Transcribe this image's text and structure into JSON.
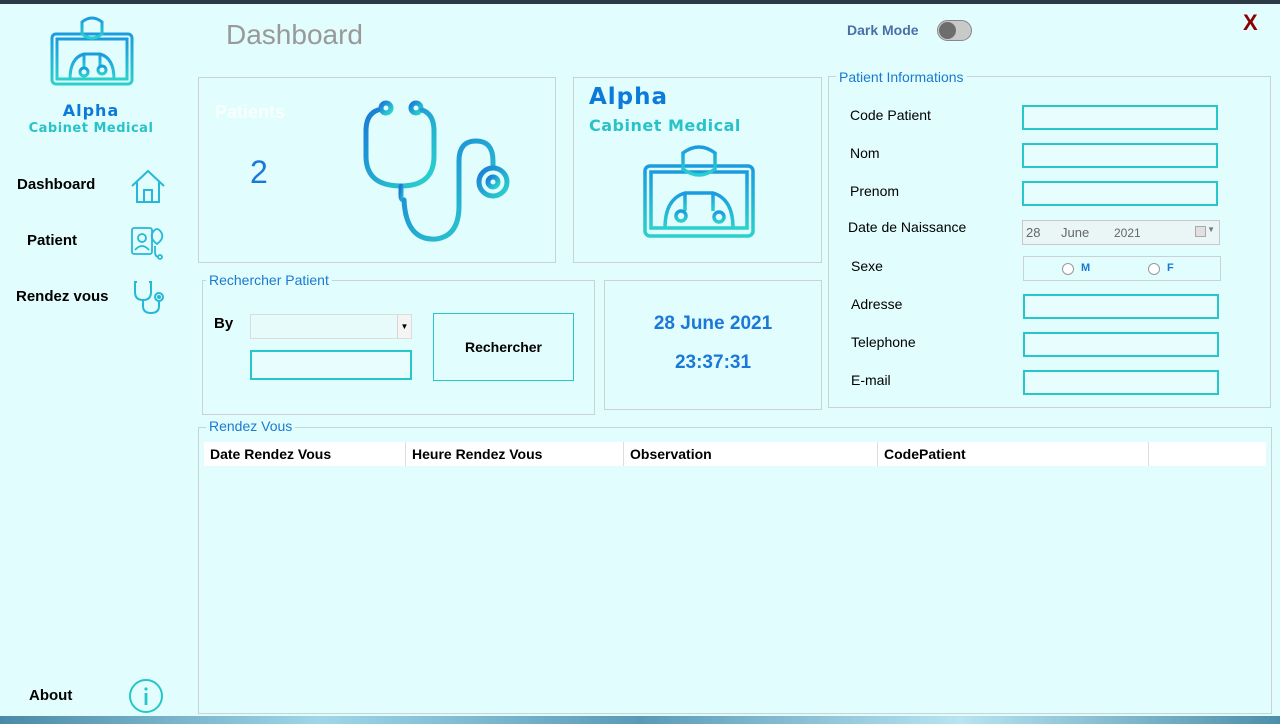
{
  "sidebar": {
    "brand_line1": "Alpha",
    "brand_line2": "Cabinet Medical",
    "items": [
      {
        "label": "Dashboard",
        "icon": "home-icon"
      },
      {
        "label": "Patient",
        "icon": "patient-card-icon"
      },
      {
        "label": "Rendez vous",
        "icon": "stethoscope-icon"
      }
    ],
    "about_label": "About"
  },
  "header": {
    "title": "Dashboard",
    "dark_mode_label": "Dark Mode",
    "dark_mode_on": false,
    "close_label": "X"
  },
  "stats": {
    "patients_label": "Patients",
    "patients_count": "2"
  },
  "brand_card": {
    "line1": "Alpha",
    "line2": "Cabinet Medical"
  },
  "search": {
    "legend": "Rechercher Patient",
    "by_label": "By",
    "by_value": "",
    "query_value": "",
    "button_label": "Rechercher"
  },
  "clock": {
    "date": "28 June 2021",
    "time": "23:37:31"
  },
  "patient_form": {
    "legend": "Patient Informations",
    "code_label": "Code Patient",
    "nom_label": "Nom",
    "prenom_label": "Prenom",
    "dob_label": "Date de Naissance",
    "dob_day": "28",
    "dob_month": "June",
    "dob_year": "2021",
    "sexe_label": "Sexe",
    "sexe_options": [
      "M",
      "F"
    ],
    "adresse_label": "Adresse",
    "telephone_label": "Telephone",
    "email_label": "E-mail"
  },
  "appointments": {
    "legend": "Rendez Vous",
    "columns": [
      "Date Rendez Vous",
      "Heure Rendez Vous",
      "Observation",
      "CodePatient"
    ],
    "rows": []
  },
  "colors": {
    "background": "#e1fdfd",
    "accent_blue": "#1a78d8",
    "accent_cyan": "#26c6cb",
    "close_red": "#8b0000"
  }
}
